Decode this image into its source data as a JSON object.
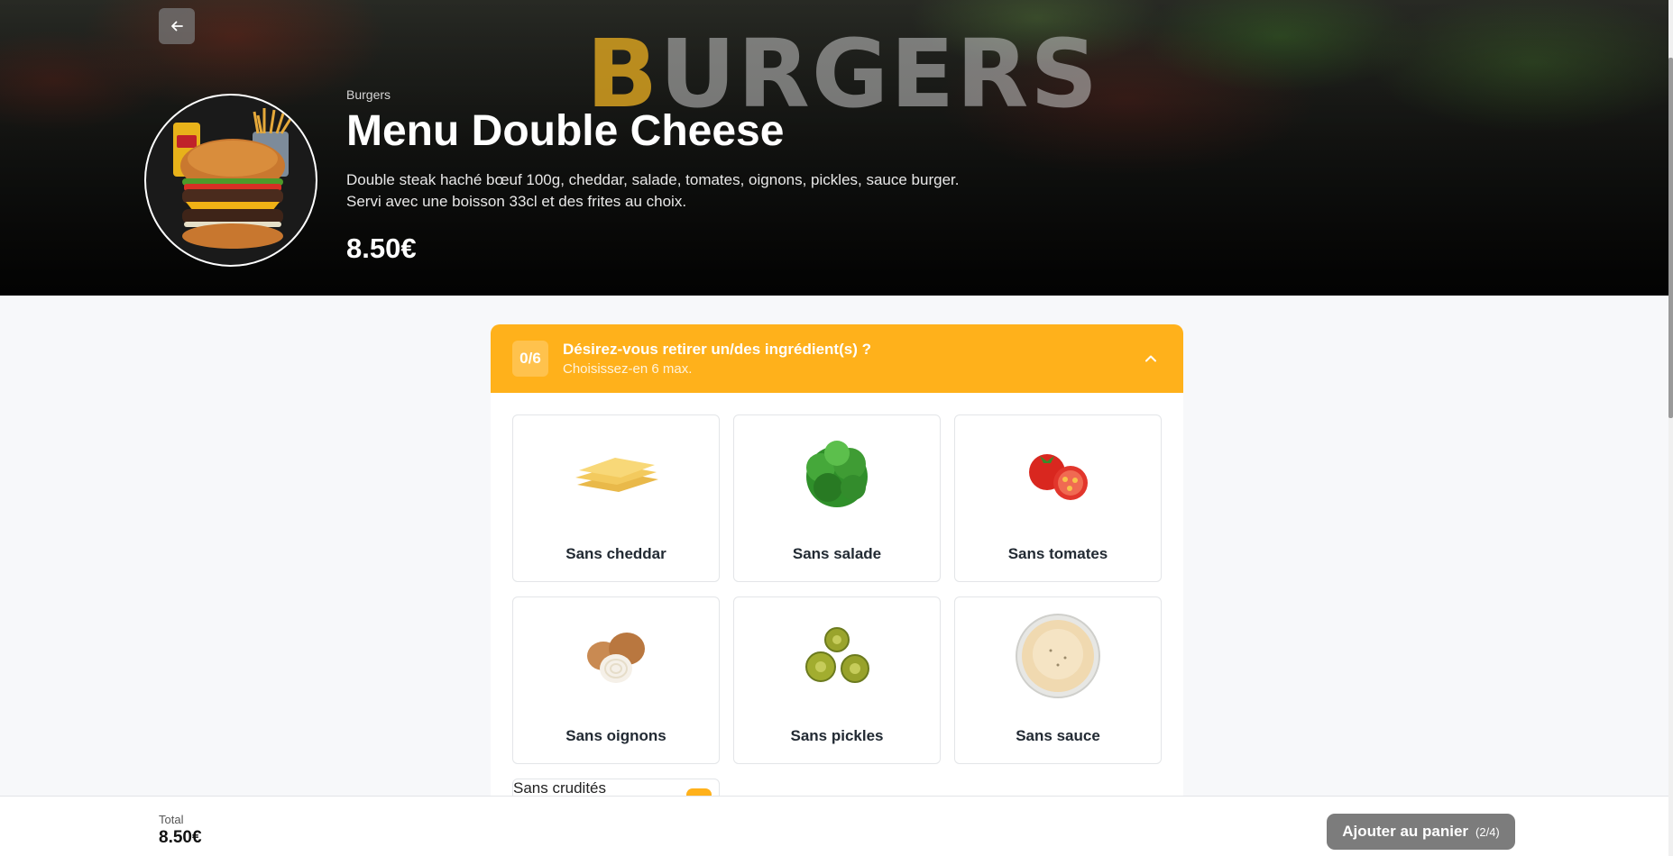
{
  "hero": {
    "watermark_first": "B",
    "watermark_rest": "URGERS",
    "category": "Burgers",
    "title": "Menu Double Cheese",
    "description": "Double steak haché bœuf 100g, cheddar, salade, tomates, oignons, pickles, sauce burger. Servi avec une boisson 33cl et des frites au choix.",
    "price": "8.50€"
  },
  "options": {
    "counter": "0/6",
    "title": "Désirez-vous retirer un/des ingrédient(s) ?",
    "subtitle": "Choisissez-en 6 max.",
    "items": [
      {
        "label": "Sans cheddar",
        "icon": "cheddar-icon"
      },
      {
        "label": "Sans salade",
        "icon": "lettuce-icon"
      },
      {
        "label": "Sans tomates",
        "icon": "tomato-icon"
      },
      {
        "label": "Sans oignons",
        "icon": "onion-icon"
      },
      {
        "label": "Sans pickles",
        "icon": "pickles-icon"
      },
      {
        "label": "Sans sauce",
        "icon": "sauce-icon"
      }
    ],
    "extra_item": {
      "label": "Sans crudités"
    }
  },
  "footer": {
    "total_label": "Total",
    "total_value": "8.50€",
    "cart_label": "Ajouter au panier",
    "cart_step": "(2/4)"
  },
  "colors": {
    "accent": "#ffb11b",
    "disabled_button": "#7c7c7c",
    "background": "#f7f8fa"
  }
}
